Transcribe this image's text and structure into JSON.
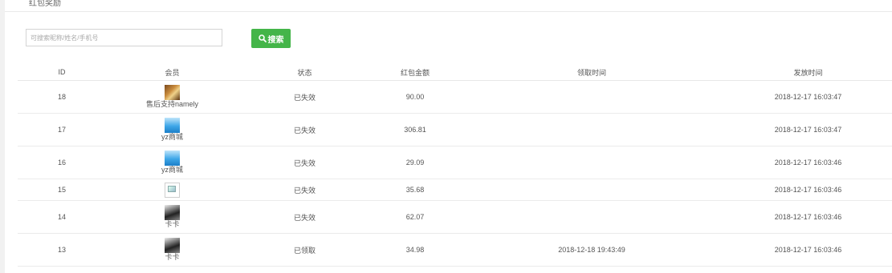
{
  "page": {
    "title": "红包奖励"
  },
  "search": {
    "placeholder": "可搜索昵称/姓名/手机号",
    "button_label": "搜索"
  },
  "table": {
    "headers": [
      "ID",
      "会员",
      "状态",
      "红包金额",
      "领取时间",
      "发放时间"
    ],
    "rows": [
      {
        "id": "18",
        "member": "售后支持namely",
        "avatar": "photo-icon",
        "status": "已失效",
        "amount": "90.00",
        "received_at": "",
        "issued_at": "2018-12-17 16:03:47"
      },
      {
        "id": "17",
        "member": "yz商城",
        "avatar": "shop-icon",
        "status": "已失效",
        "amount": "306.81",
        "received_at": "",
        "issued_at": "2018-12-17 16:03:47"
      },
      {
        "id": "16",
        "member": "yz商城",
        "avatar": "shop-icon",
        "status": "已失效",
        "amount": "29.09",
        "received_at": "",
        "issued_at": "2018-12-17 16:03:46"
      },
      {
        "id": "15",
        "member": "",
        "avatar": "broken-image-icon",
        "status": "已失效",
        "amount": "35.68",
        "received_at": "",
        "issued_at": "2018-12-17 16:03:46"
      },
      {
        "id": "14",
        "member": "卡卡",
        "avatar": "photo-icon",
        "status": "已失效",
        "amount": "62.07",
        "received_at": "",
        "issued_at": "2018-12-17 16:03:46"
      },
      {
        "id": "13",
        "member": "卡卡",
        "avatar": "photo-icon",
        "status": "已领取",
        "amount": "34.98",
        "received_at": "2018-12-18 19:43:49",
        "issued_at": "2018-12-17 16:03:46"
      }
    ]
  },
  "colors": {
    "accent": "#44b549"
  }
}
